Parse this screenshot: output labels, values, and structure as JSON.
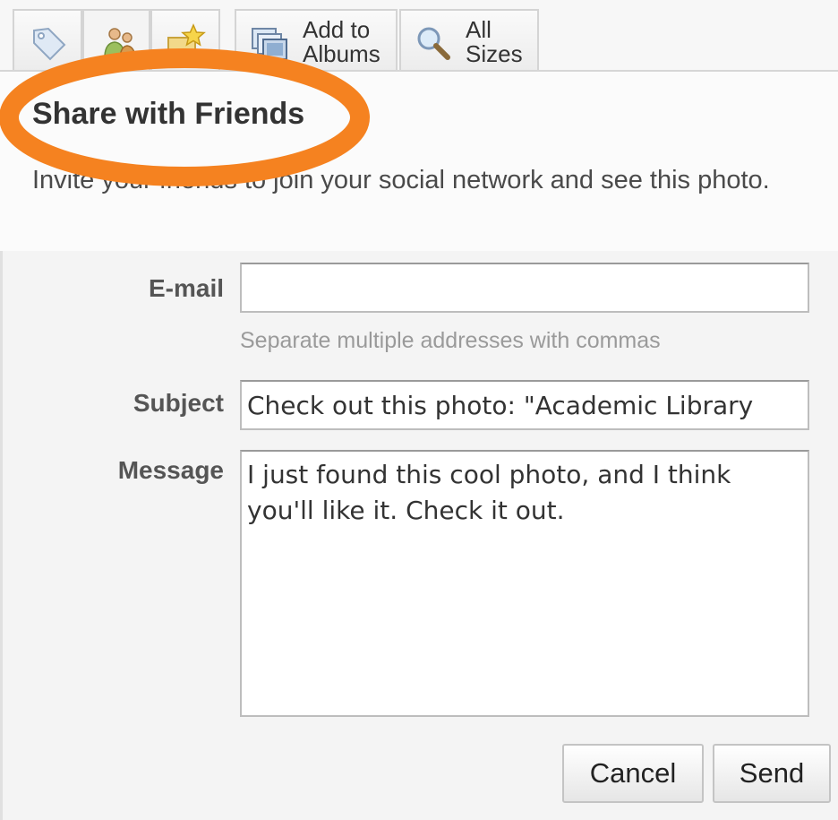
{
  "tabs": {
    "tags": {
      "icon": "tag-icon"
    },
    "share": {
      "icon": "people-icon"
    },
    "favorite": {
      "icon": "star-icon"
    },
    "add_to_albums": {
      "line1": "Add to",
      "line2": "Albums",
      "icon": "albums-icon"
    },
    "all_sizes": {
      "line1": "All",
      "line2": "Sizes",
      "icon": "magnifier-icon"
    }
  },
  "share": {
    "title": "Share with Friends",
    "description": "Invite your friends to join your social network and see this photo.",
    "email": {
      "label": "E-mail",
      "value": "",
      "hint": "Separate multiple addresses with commas"
    },
    "subject": {
      "label": "Subject",
      "value": "Check out this photo: \"Academic Library"
    },
    "message": {
      "label": "Message",
      "value": "I just found this cool photo, and I think you'll like it. Check it out."
    },
    "cancel_label": "Cancel",
    "send_label": "Send"
  },
  "colors": {
    "highlight": "#f58220",
    "panel": "#f4f4f4",
    "border": "#d4d4d4"
  }
}
